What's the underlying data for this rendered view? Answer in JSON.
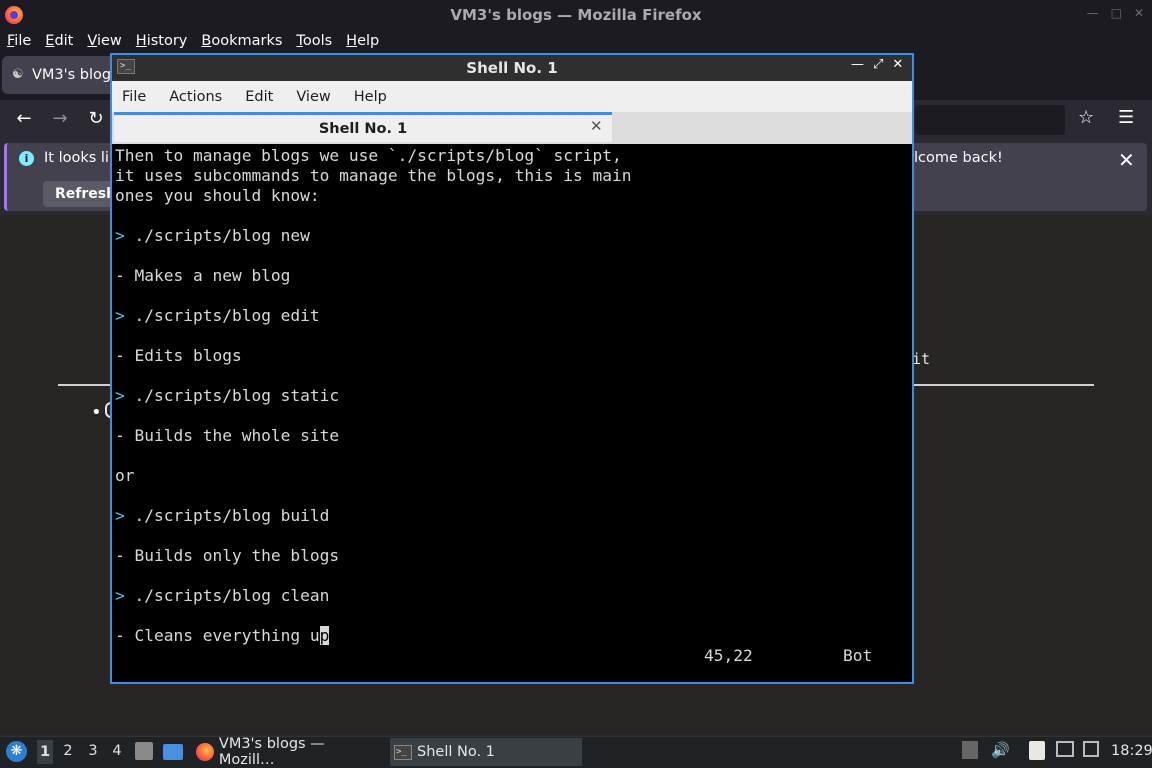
{
  "firefox": {
    "window_title": "VM3's blogs — Mozilla Firefox",
    "menu": [
      "File",
      "Edit",
      "View",
      "History",
      "Bookmarks",
      "Tools",
      "Help"
    ],
    "tab_title": "VM3's blogs",
    "notification": {
      "text_left": "It looks lik",
      "text_right": "lcome back!",
      "refresh_label": "Refresh"
    },
    "page_edge_text": "it"
  },
  "terminal": {
    "window_title": "Shell No. 1",
    "menu": [
      "File",
      "Actions",
      "Edit",
      "View",
      "Help"
    ],
    "tab_title": "Shell No. 1",
    "lines": [
      {
        "prompt": "",
        "text": "Then to manage blogs we use `./scripts/blog` script,"
      },
      {
        "prompt": "",
        "text": "it uses subcommands to manage the blogs, this is main"
      },
      {
        "prompt": "",
        "text": "ones you should know:"
      },
      {
        "prompt": "",
        "text": ""
      },
      {
        "prompt": ">",
        "text": " ./scripts/blog new"
      },
      {
        "prompt": "",
        "text": ""
      },
      {
        "prompt": "",
        "text": "- Makes a new blog"
      },
      {
        "prompt": "",
        "text": ""
      },
      {
        "prompt": ">",
        "text": " ./scripts/blog edit"
      },
      {
        "prompt": "",
        "text": ""
      },
      {
        "prompt": "",
        "text": "- Edits blogs"
      },
      {
        "prompt": "",
        "text": ""
      },
      {
        "prompt": ">",
        "text": " ./scripts/blog static"
      },
      {
        "prompt": "",
        "text": ""
      },
      {
        "prompt": "",
        "text": "- Builds the whole site"
      },
      {
        "prompt": "",
        "text": ""
      },
      {
        "prompt": "",
        "text": "or"
      },
      {
        "prompt": "",
        "text": ""
      },
      {
        "prompt": ">",
        "text": " ./scripts/blog build"
      },
      {
        "prompt": "",
        "text": ""
      },
      {
        "prompt": "",
        "text": "- Builds only the blogs"
      },
      {
        "prompt": "",
        "text": ""
      },
      {
        "prompt": ">",
        "text": " ./scripts/blog clean"
      },
      {
        "prompt": "",
        "text": ""
      },
      {
        "prompt": "",
        "text": "- Cleans everything u",
        "cursor_char": "p"
      }
    ],
    "status": {
      "position": "45,22",
      "scroll": "Bot"
    },
    "prompt_color": "#4fc1e9"
  },
  "taskbar": {
    "workspaces": [
      "1",
      "2",
      "3",
      "4"
    ],
    "tasks": [
      {
        "label": "VM3's blogs — Mozill…",
        "icon": "firefox-icon"
      },
      {
        "label": "Shell No. 1",
        "icon": "terminal-icon"
      }
    ],
    "clock": "18:29"
  },
  "colors": {
    "accent": "#3d8ee0",
    "notification_accent": "#a970ff"
  }
}
